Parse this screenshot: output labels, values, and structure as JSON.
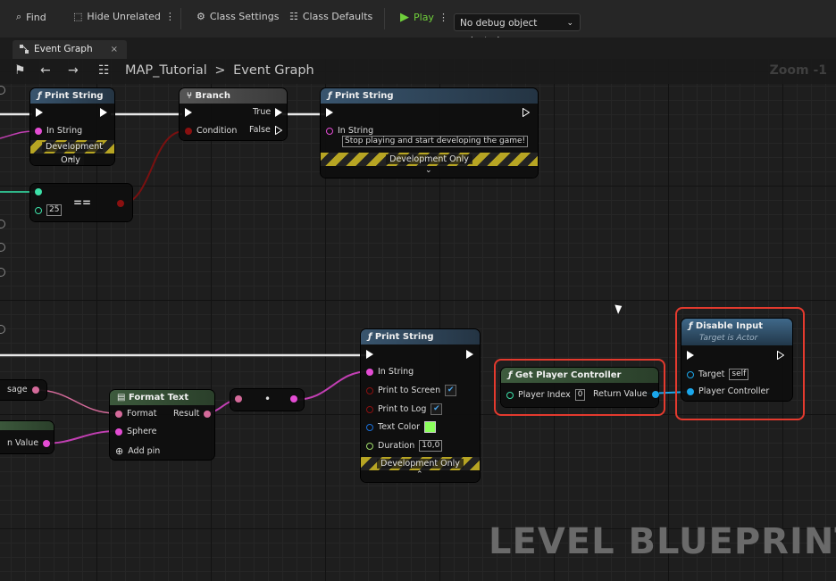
{
  "toolbar": {
    "find": "Find",
    "hide_unrelated": "Hide Unrelated",
    "class_settings": "Class Settings",
    "class_defaults": "Class Defaults",
    "play": "Play",
    "debug_select": "No debug object selected"
  },
  "tab": {
    "label": "Event Graph",
    "close": "×"
  },
  "breadcrumb": {
    "root": "MAP_Tutorial",
    "sep": ">",
    "current": "Event Graph"
  },
  "zoom": "Zoom -1",
  "nodes": {
    "print1": {
      "title": "Print String",
      "in_string": "In String",
      "dev": "Development Only"
    },
    "branch": {
      "title": "Branch",
      "condition": "Condition",
      "true": "True",
      "false": "False"
    },
    "print2": {
      "title": "Print String",
      "in_string": "In String",
      "value": "Stop playing and start developing the game!",
      "dev": "Development Only"
    },
    "equals": {
      "value": "25",
      "op": "=="
    },
    "print3": {
      "title": "Print String",
      "in_string": "In String",
      "print_to_screen": "Print to Screen",
      "print_to_log": "Print to Log",
      "text_color": "Text Color",
      "duration": "Duration",
      "duration_value": "10,0",
      "dev": "Development Only"
    },
    "format_text": {
      "title": "Format Text",
      "format": "Format",
      "result": "Result",
      "sphere": "Sphere",
      "add_pin": "Add pin"
    },
    "reroute": {
      "label": "•"
    },
    "get_pc": {
      "title": "Get Player Controller",
      "player_index": "Player Index",
      "player_index_value": "0",
      "return_value": "Return Value"
    },
    "disable_input": {
      "title": "Disable Input",
      "subtitle": "Target is Actor",
      "target": "Target",
      "target_value": "self",
      "player_controller": "Player Controller"
    },
    "left_partial": {
      "message": "sage",
      "value": "n Value"
    }
  },
  "watermark": "LEVEL BLUEPRINT",
  "colors": {
    "exec": "#ffffff",
    "string": "#e44cd4",
    "bool": "#8a1010",
    "int": "#3de0a8",
    "object": "#1aa7ec",
    "highlight": "#e43a2e"
  }
}
